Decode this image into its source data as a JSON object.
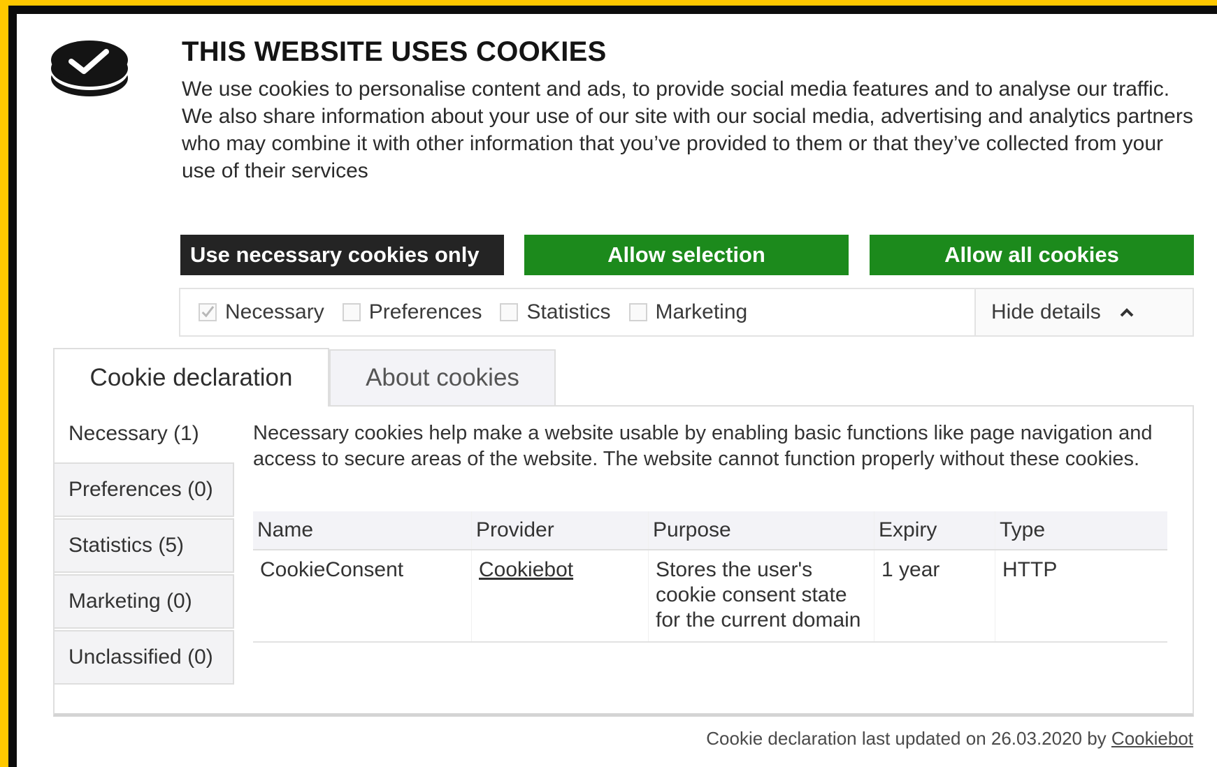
{
  "dialog": {
    "title": "THIS WEBSITE USES COOKIES",
    "intro": "We use cookies to personalise content and ads, to provide social media features and to analyse our traffic. We also share information about your use of our site with our social media, advertising and analytics partners who may combine it with other information that you’ve provided to them or that they’ve collected from your use of their services"
  },
  "buttons": {
    "necessary_only": "Use necessary cookies only",
    "allow_selection": "Allow selection",
    "allow_all": "Allow all cookies"
  },
  "options": {
    "necessary": {
      "label": "Necessary",
      "checked": true
    },
    "preferences": {
      "label": "Preferences",
      "checked": false
    },
    "statistics": {
      "label": "Statistics",
      "checked": false
    },
    "marketing": {
      "label": "Marketing",
      "checked": false
    },
    "hide_details": "Hide details"
  },
  "tabs": [
    "Cookie declaration",
    "About cookies"
  ],
  "categories": [
    {
      "label": "Necessary (1)"
    },
    {
      "label": "Preferences (0)"
    },
    {
      "label": "Statistics (5)"
    },
    {
      "label": "Marketing (0)"
    },
    {
      "label": "Unclassified (0)"
    }
  ],
  "necessary_description": "Necessary cookies help make a website usable by enabling basic functions like page navigation and access to secure areas of the website. The website cannot function properly without these cookies.",
  "table": {
    "headers": [
      "Name",
      "Provider",
      "Purpose",
      "Expiry",
      "Type"
    ],
    "rows": [
      {
        "name": "CookieConsent",
        "provider": "Cookiebot",
        "purpose": "Stores the user's cookie consent state for the current domain",
        "expiry": "1 year",
        "type": "HTTP"
      }
    ]
  },
  "footer": {
    "text": "Cookie declaration last updated on 26.03.2020 by",
    "link": "Cookiebot"
  },
  "colors": {
    "background": "#ffc800",
    "frame": "#0c0c0c",
    "dark_button": "#242424",
    "green_button": "#1c8a1c"
  },
  "icons": [
    "cookie-consent-checkmark-logo-icon",
    "checkmark-icon",
    "chevron-up-icon"
  ]
}
